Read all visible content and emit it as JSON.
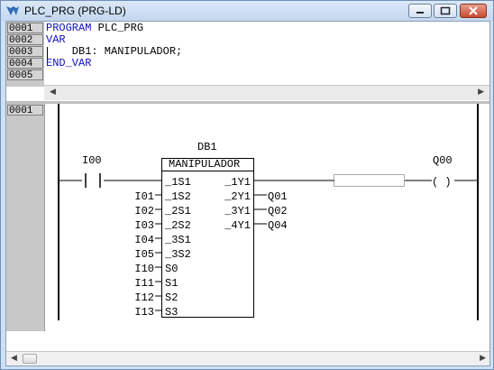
{
  "window": {
    "title": "PLC_PRG (PRG-LD)"
  },
  "declaration": {
    "line_numbers": [
      "0001",
      "0002",
      "0003",
      "0004",
      "0005"
    ],
    "lines": [
      {
        "kw": "PROGRAM",
        "rest": " PLC_PRG"
      },
      {
        "kw": "VAR",
        "rest": ""
      },
      {
        "kw": "",
        "rest": "    DB1: MANIPULADOR;"
      },
      {
        "kw": "END_VAR",
        "rest": ""
      },
      {
        "kw": "",
        "rest": ""
      }
    ]
  },
  "network": {
    "number": "0001",
    "contact": {
      "label": "I00"
    },
    "coil": {
      "label": "Q00",
      "symbol": "( )"
    },
    "block": {
      "instance": "DB1",
      "type": "MANIPULADOR",
      "inputs": [
        {
          "var": "",
          "pin": "_1S1"
        },
        {
          "var": "I01",
          "pin": "_1S2"
        },
        {
          "var": "I02",
          "pin": "_2S1"
        },
        {
          "var": "I03",
          "pin": "_2S2"
        },
        {
          "var": "I04",
          "pin": "_3S1"
        },
        {
          "var": "I05",
          "pin": "_3S2"
        },
        {
          "var": "I10",
          "pin": "S0"
        },
        {
          "var": "I11",
          "pin": "S1"
        },
        {
          "var": "I12",
          "pin": "S2"
        },
        {
          "var": "I13",
          "pin": "S3"
        }
      ],
      "outputs": [
        {
          "pin": "_1Y1",
          "var": ""
        },
        {
          "pin": "_2Y1",
          "var": "Q01"
        },
        {
          "pin": "_3Y1",
          "var": "Q02"
        },
        {
          "pin": "_4Y1",
          "var": "Q04"
        }
      ]
    }
  }
}
